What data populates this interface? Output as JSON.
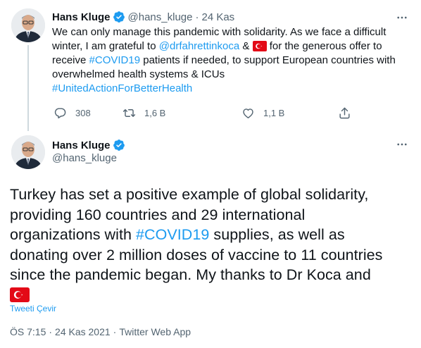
{
  "colors": {
    "accent": "#1d9bf0",
    "text": "#0f1419",
    "muted": "#536471",
    "flag_red": "#e30a17"
  },
  "tweet1": {
    "name": "Hans Kluge",
    "handle": "@hans_kluge",
    "separator": "·",
    "date": "24 Kas",
    "text": {
      "l1": "We can only manage this pandemic with solidarity. As we face a difficult",
      "l2a": "winter, I am grateful to ",
      "l2_mention": "@drfahrettinkoca",
      "l2b": " & ",
      "l2c": " for the generous offer to",
      "l3a": "receive ",
      "l3_hashtag": "#COVID19",
      "l3b": " patients if needed, to support European countries with",
      "l4": "overwhelmed health systems & ICUs",
      "l5_hashtag": "#UnitedActionForBetterHealth"
    },
    "actions": {
      "replies": "308",
      "retweets": "1,6 B",
      "likes": "1,1 B"
    }
  },
  "tweet2": {
    "name": "Hans Kluge",
    "handle": "@hans_kluge",
    "text": {
      "l1": "Turkey has set a positive example of global solidarity,",
      "l2": "providing 160 countries and 29 international",
      "l3_hashtag": "#COVID19",
      "l3a": "organizations with ",
      "l3b": " supplies, as well as",
      "l4": "donating over 2 million doses of vaccine to 11 countries",
      "l5": "since the pandemic began. My thanks to Dr Koca and"
    },
    "translate_label": "Tweeti Çevir",
    "meta": {
      "time": "ÖS 7:15",
      "sep": "·",
      "date": "24 Kas 2021",
      "source": "Twitter Web App"
    }
  },
  "icons": [
    "verified-badge-icon",
    "more-icon",
    "reply-icon",
    "retweet-icon",
    "like-icon",
    "share-icon",
    "turkey-flag-icon"
  ]
}
